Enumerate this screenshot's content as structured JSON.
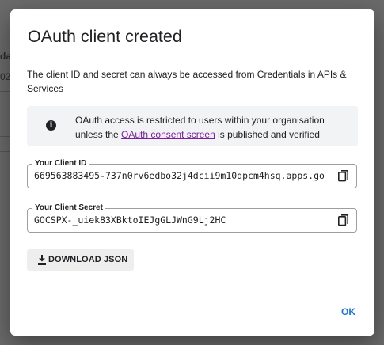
{
  "background": {
    "fragment_1": "da",
    "fragment_2": "02"
  },
  "dialog": {
    "title": "OAuth client created",
    "description": "The client ID and secret can always be accessed from Credentials in APIs & Services",
    "info": {
      "text_before": "OAuth access is restricted to users within your organisation unless the ",
      "link_text": "OAuth consent screen",
      "text_after": " is published and verified"
    },
    "client_id": {
      "label": "Your Client ID",
      "value": "669563883495-737n0rv6edbo32j4dcii9m10qpcm4hsq.apps.go"
    },
    "client_secret": {
      "label": "Your Client Secret",
      "value": "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"
    },
    "download_button": {
      "label": "DOWNLOAD JSON",
      "icon": "download-icon"
    },
    "copy_icon": "copy-icon",
    "info_icon": "info-icon",
    "ok_button": {
      "label": "OK"
    }
  },
  "colors": {
    "accent": "#1a73e8",
    "link": "#7b1fa2",
    "info_background": "#f1f3f4",
    "button_background": "#eeeeee"
  }
}
